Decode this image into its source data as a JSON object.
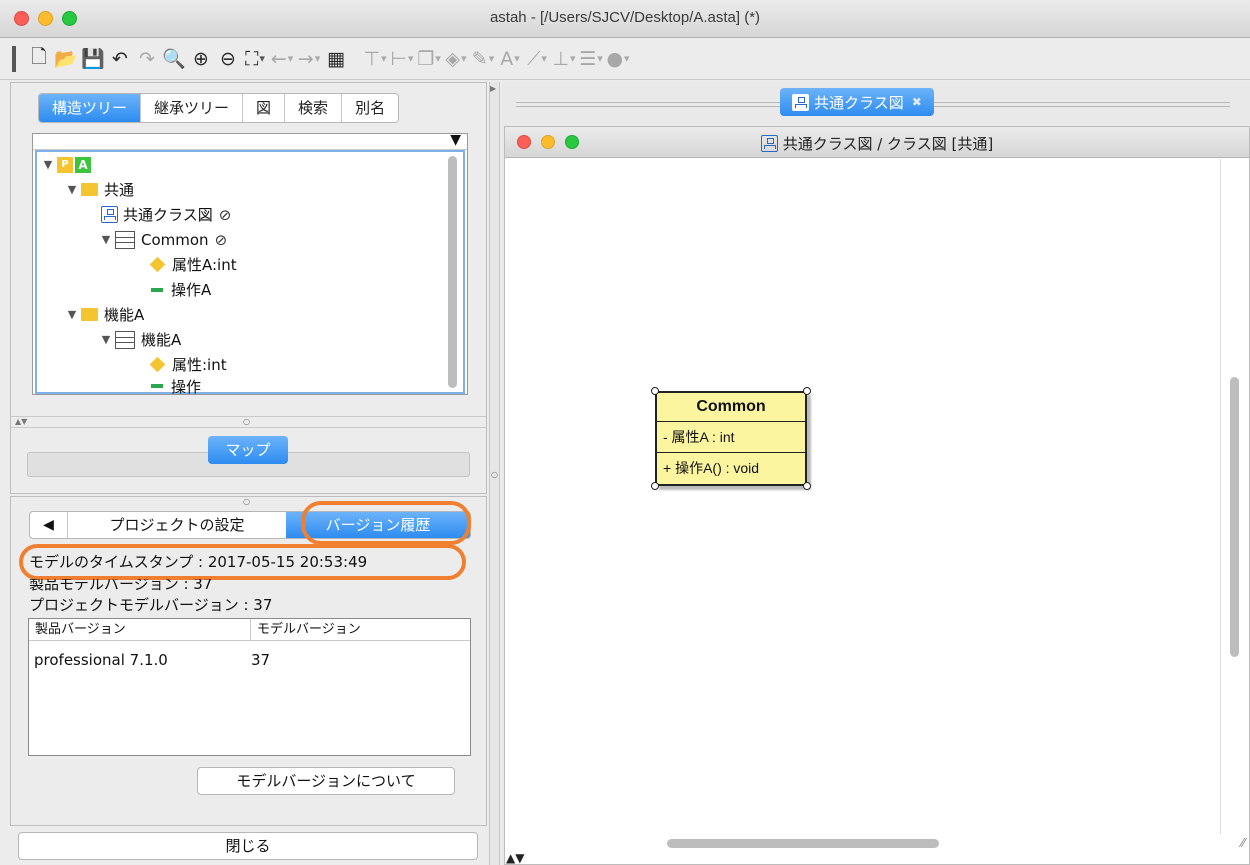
{
  "window": {
    "title": "astah - [/Users/SJCV/Desktop/A.asta] (*)"
  },
  "toolbar": {
    "icons": [
      "new-icon",
      "open-icon",
      "save-icon",
      "undo-icon",
      "redo-icon",
      "zoom-fit-icon",
      "zoom-in-icon",
      "zoom-out-icon",
      "fit-window-icon",
      "back-icon",
      "forward-icon",
      "grid-icon",
      "align-top-icon",
      "align-left-icon",
      "arrange-icon",
      "fill-color-icon",
      "line-color-icon",
      "font-color-icon",
      "line-style-icon",
      "layout-icon",
      "distribute-icon",
      "palette-icon"
    ]
  },
  "structure_tabs": [
    "構造ツリー",
    "継承ツリー",
    "図",
    "検索",
    "別名"
  ],
  "tree": [
    {
      "label": "A",
      "type": "project"
    },
    {
      "label": "共通",
      "type": "folder"
    },
    {
      "label": "共通クラス図",
      "type": "diagram"
    },
    {
      "label": "Common",
      "type": "class"
    },
    {
      "label": "属性A:int",
      "type": "attribute"
    },
    {
      "label": "操作A",
      "type": "operation"
    },
    {
      "label": "機能A",
      "type": "folder"
    },
    {
      "label": "機能A",
      "type": "class"
    },
    {
      "label": "属性:int",
      "type": "attribute"
    },
    {
      "label": "操作",
      "type": "operation"
    }
  ],
  "tree_project_badge": "P",
  "map_button": "マップ",
  "props": {
    "tab_back": "◀",
    "tab_project_settings": "プロジェクトの設定",
    "tab_version_history": "バージョン履歴",
    "timestamp": "モデルのタイムスタンプ : 2017-05-15 20:53:49",
    "product_model_version": "製品モデルバージョン : 37",
    "project_model_version": "プロジェクトモデルバージョン : 37",
    "table": {
      "headers": [
        "製品バージョン",
        "モデルバージョン"
      ],
      "rows": [
        [
          "professional 7.1.0",
          "37"
        ]
      ]
    },
    "about_button": "モデルバージョンについて"
  },
  "close_button": "閉じる",
  "diagram": {
    "tab_label": "共通クラス図",
    "window_title": "共通クラス図 / クラス図 [共通]",
    "class": {
      "name": "Common",
      "attribute": "- 属性A : int",
      "operation": "+ 操作A() : void"
    }
  },
  "colors": {
    "accent": "#2d8cf0",
    "highlight": "#f07f2f",
    "class_fill": "#fcf5a0"
  }
}
